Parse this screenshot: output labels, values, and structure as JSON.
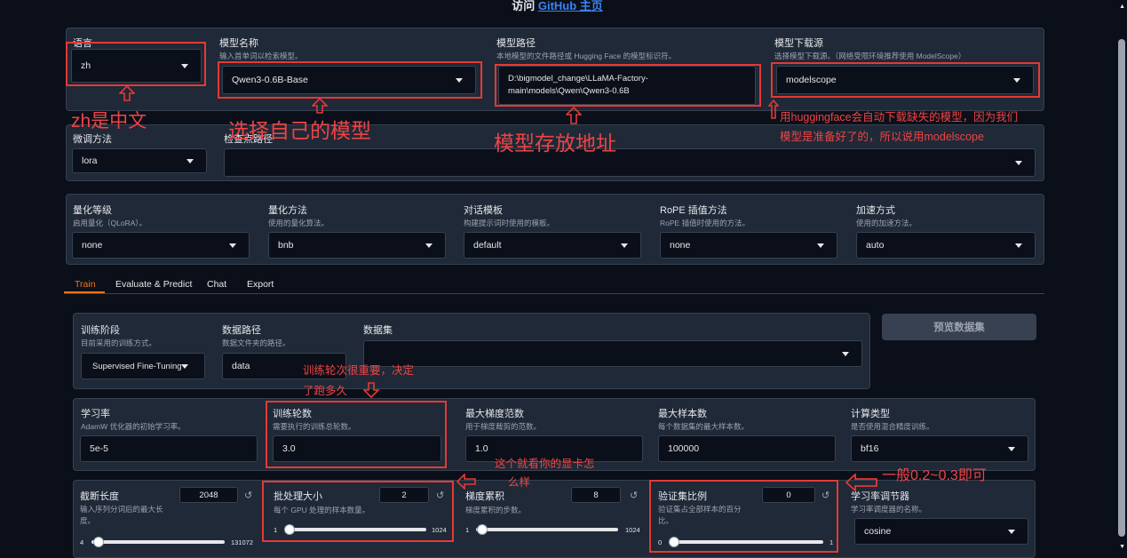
{
  "header": {
    "prefix": "访问",
    "link": "GitHub 主页"
  },
  "top": {
    "lang_label": "语言",
    "lang_value": "zh",
    "model_name_label": "模型名称",
    "model_name_sub": "输入首单词以检索模型。",
    "model_name_value": "Qwen3-0.6B-Base",
    "model_path_label": "模型路径",
    "model_path_sub": "本地模型的文件路径或 Hugging Face 的模型标识符。",
    "model_path_line1": "D:\\bigmodel_change\\LLaMA-Factory-",
    "model_path_line2": "main\\models\\Qwen\\Qwen3-0.6B",
    "source_label": "模型下载源",
    "source_sub": "选择模型下载源。（网络受限环境推荐使用 ModelScope）",
    "source_value": "modelscope",
    "finetune_label": "微调方法",
    "finetune_value": "lora",
    "ckpt_label": "检查点路径"
  },
  "quant": {
    "q_bit_label": "量化等级",
    "q_bit_sub": "启用量化（QLoRA）。",
    "q_bit_value": "none",
    "q_method_label": "量化方法",
    "q_method_sub": "使用的量化算法。",
    "q_method_value": "bnb",
    "template_label": "对话模板",
    "template_sub": "构建提示词时使用的模板。",
    "template_value": "default",
    "rope_label": "RoPE 插值方法",
    "rope_sub": "RoPE 插值时使用的方法。",
    "rope_value": "none",
    "booster_label": "加速方式",
    "booster_sub": "使用的加速方法。",
    "booster_value": "auto"
  },
  "tabs": [
    "Train",
    "Evaluate & Predict",
    "Chat",
    "Export"
  ],
  "train": {
    "stage_label": "训练阶段",
    "stage_sub": "目前采用的训练方式。",
    "stage_value": "Supervised Fine-Tuning",
    "dataset_dir_label": "数据路径",
    "dataset_dir_sub": "数据文件夹的路径。",
    "dataset_dir_value": "data",
    "dataset_label": "数据集",
    "preview_button": "预览数据集",
    "lr_label": "学习率",
    "lr_sub": "AdamW 优化器的初始学习率。",
    "lr_value": "5e-5",
    "epochs_label": "训练轮数",
    "epochs_sub": "需要执行的训练总轮数。",
    "epochs_value": "3.0",
    "grad_norm_label": "最大梯度范数",
    "grad_norm_sub": "用于梯度裁剪的范数。",
    "grad_norm_value": "1.0",
    "max_samples_label": "最大样本数",
    "max_samples_sub": "每个数据集的最大样本数。",
    "max_samples_value": "100000",
    "compute_label": "计算类型",
    "compute_sub": "是否使用混合精度训练。",
    "compute_value": "bf16",
    "cutoff_label": "截断长度",
    "cutoff_sub1": "输入序列分词后的最大长",
    "cutoff_sub2": "度。",
    "cutoff_value": "2048",
    "cutoff_min": "4",
    "cutoff_max": "131072",
    "cutoff_fraction": 0.016,
    "batch_label": "批处理大小",
    "batch_sub": "每个 GPU 处理的样本数量。",
    "batch_value": "2",
    "batch_min": "1",
    "batch_max": "1024",
    "batch_fraction": 0.001,
    "accum_label": "梯度累积",
    "accum_sub": "梯度累积的步数。",
    "accum_value": "8",
    "accum_min": "1",
    "accum_max": "1024",
    "accum_fraction": 0.007,
    "val_label": "验证集比例",
    "val_sub1": "验证集占全部样本的百分",
    "val_sub2": "比。",
    "val_value": "0",
    "val_min": "0",
    "val_max": "1",
    "val_fraction": 0.0,
    "scheduler_label": "学习率调节器",
    "scheduler_sub": "学习率调度器的名称。",
    "scheduler_value": "cosine"
  },
  "annotations": {
    "lang": "zh是中文",
    "model": "选择自己的模型",
    "path": "模型存放地址",
    "source1": "用huggingface会自动下载缺失的模型，因为我们",
    "source2": "模型是准备好了的，所以说用modelscope",
    "epochs1": "训练轮次很重要，决定",
    "epochs2": "了跑多久",
    "batch1": "这个就看你的显卡怎",
    "batch2": "么样",
    "val": "一般0.2~0.3即可"
  },
  "colors": {
    "annotation": "#e53935",
    "accent": "#f97316",
    "background": "#0b0f19",
    "panel": "#1f2937"
  }
}
